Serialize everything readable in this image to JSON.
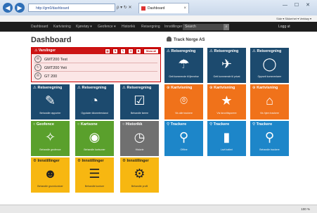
{
  "browser": {
    "url": "http://gm0/dashboard",
    "tab_title": "Dashboard",
    "back_glyph": "◀",
    "forward_glyph": "▶",
    "addr_controls": "ρ ▾ ↻ ✕",
    "tab_close": "×",
    "window_controls": "— ☐ ✕",
    "command_bar": "Side ▾  Sikkerhet ▾  Verktøy ▾"
  },
  "nav": {
    "items": [
      "Dashboard",
      "Kartvisning",
      "Kjøretøy ▾",
      "Geofence ▾",
      "Historikk",
      "Reisergning",
      "Innstillinger"
    ],
    "search_placeholder": "Search",
    "search_icon": "⌕",
    "logout": "Logg ut"
  },
  "page": {
    "title": "Dashboard",
    "company": "Track Norge AS"
  },
  "alerts": {
    "title": "Varslinger",
    "warning_icon": "⚠",
    "toolbar_buttons": [
      "▦",
      "⇅",
      "✎",
      "☰",
      "✖"
    ],
    "show_all": "Show all",
    "items": [
      {
        "icon": "✉",
        "time": "",
        "message": "GMT200 Test"
      },
      {
        "icon": "↻",
        "time": "",
        "message": "GMT200 Yeti"
      },
      {
        "icon": "✉",
        "time": "",
        "message": "GT 200"
      }
    ]
  },
  "tiles": [
    {
      "label": "Reiseregning",
      "glyph": "✎",
      "sub": "Behandle rapporter",
      "color": "dark",
      "icon": "edit-icon"
    },
    {
      "label": "Reiseregning",
      "glyph": "◔",
      "sub": "Oppdater kilometerstand",
      "color": "dark",
      "icon": "gauge-icon"
    },
    {
      "label": "Reiseregning",
      "glyph": "☑",
      "sub": "Behandle førere",
      "color": "dark",
      "icon": "driver-icon"
    },
    {
      "label": "Kartvisning",
      "glyph": "⌾",
      "sub": "Vis alle trackere",
      "color": "orange",
      "icon": "map-pin-icon"
    },
    {
      "label": "Kartvisning",
      "glyph": "★",
      "sub": "Vis favorittsporere",
      "color": "orange",
      "icon": "star-icon"
    },
    {
      "label": "Kartvisning",
      "glyph": "⌂",
      "sub": "Vis hjem trackere",
      "color": "orange",
      "icon": "home-icon"
    },
    {
      "label": "Geofence",
      "glyph": "✧",
      "sub": "Behandle geofence",
      "color": "green",
      "icon": "geofence-icon"
    },
    {
      "label": "Kartsone",
      "glyph": "◉",
      "sub": "Behandle kartsoner",
      "color": "green",
      "icon": "globe-icon"
    },
    {
      "label": "Historikk",
      "glyph": "◷",
      "sub": "Historie",
      "color": "gray",
      "icon": "clock-icon"
    },
    {
      "label": "Trackere",
      "glyph": "⚲",
      "sub": "Offline",
      "color": "blue",
      "icon": "tracker-icon"
    },
    {
      "label": "Trackere",
      "glyph": "▮",
      "sub": "Lavt batteri",
      "color": "blue",
      "icon": "battery-icon"
    },
    {
      "label": "Trackere",
      "glyph": "⚲",
      "sub": "Behandle trackere",
      "color": "blue",
      "icon": "tracker-icon"
    },
    {
      "label": "Innstillinger",
      "glyph": "☻",
      "sub": "Behandle grunnkontoer",
      "color": "yellow",
      "icon": "user-icon"
    },
    {
      "label": "Innstillinger",
      "glyph": "☰",
      "sub": "Behandle kontoer",
      "color": "yellow",
      "icon": "list-icon"
    },
    {
      "label": "Innstillinger",
      "glyph": "⚙",
      "sub": "Behandle profil",
      "color": "yellow",
      "icon": "gear-icon"
    }
  ],
  "top_right_tiles": [
    {
      "label": "Reiseregning",
      "glyph": "☂",
      "sub": "Gett kommende til fjernelse",
      "color": "dark",
      "icon": "person-icon"
    },
    {
      "label": "Reiseregning",
      "glyph": "✈",
      "sub": "Gett kommende til privat",
      "color": "dark",
      "icon": "beach-icon"
    },
    {
      "label": "Reiseregning",
      "glyph": "◯",
      "sub": "Oppsett kommentarer",
      "color": "dark",
      "icon": "comment-icon"
    }
  ],
  "statusbar": {
    "zoom": "100 %"
  }
}
